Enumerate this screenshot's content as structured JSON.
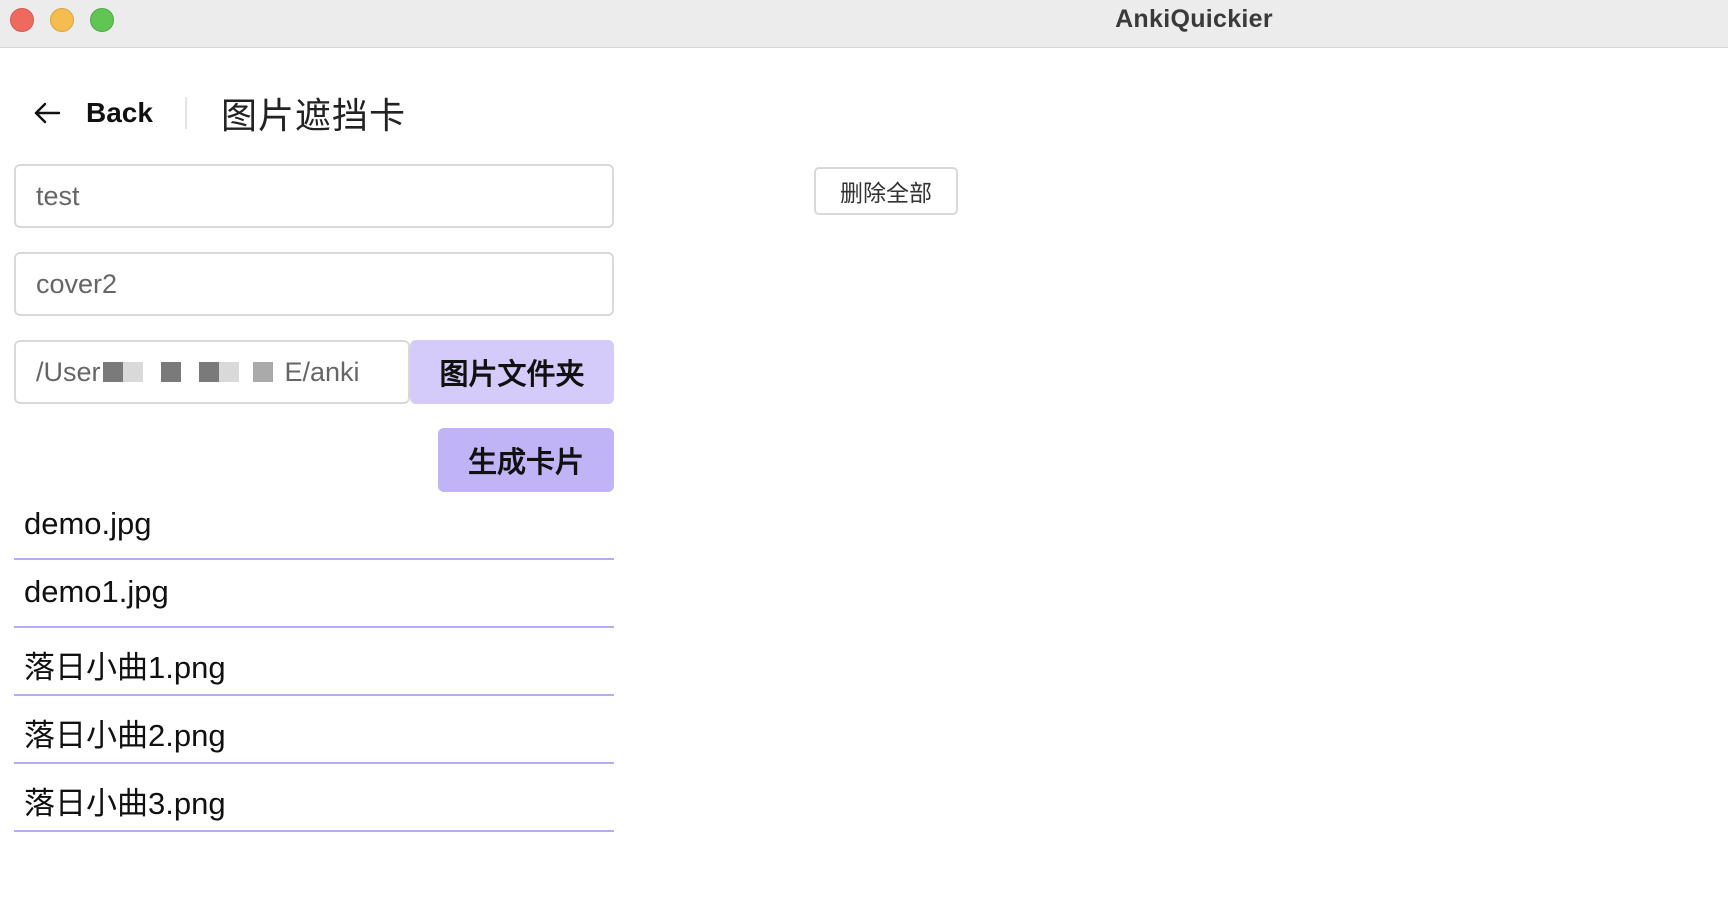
{
  "window": {
    "title": "AnkiQuickier"
  },
  "header": {
    "back_label": "Back",
    "page_title": "图片遮挡卡"
  },
  "form": {
    "deck_value": "test",
    "tag_value": "cover2",
    "path_start": "/User",
    "path_end": "E/anki",
    "folder_button": "图片文件夹",
    "generate_button": "生成卡片"
  },
  "actions": {
    "delete_all": "删除全部"
  },
  "files": [
    "demo.jpg",
    "demo1.jpg",
    "落日小曲1.png",
    "落日小曲2.png",
    "落日小曲3.png"
  ],
  "colors": {
    "folder_button_bg": "#d4cbfa",
    "generate_button_bg": "#c0b4f6",
    "list_divider": "#b6acf2",
    "titlebar_bg": "#ececec"
  }
}
